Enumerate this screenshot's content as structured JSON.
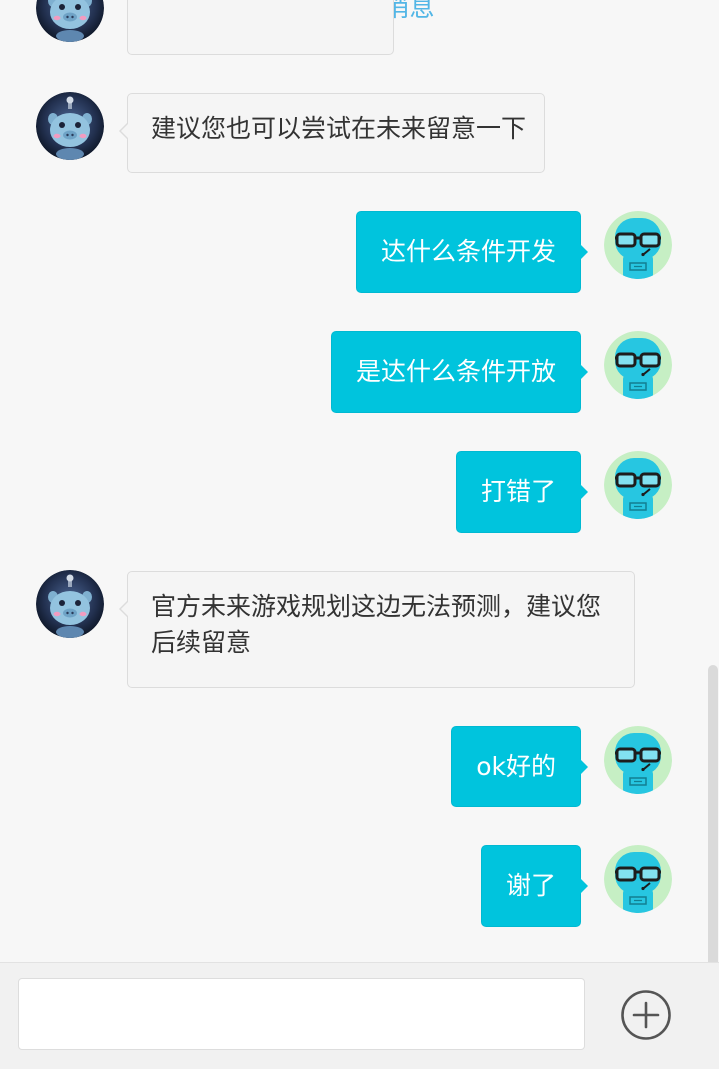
{
  "header": {
    "load_earlier_label": "查看更早消息"
  },
  "participants": {
    "agent": {
      "avatar_icon": "pig-robot-avatar"
    },
    "user": {
      "avatar_icon": "glasses-robot-avatar"
    }
  },
  "messages": [
    {
      "from": "agent",
      "text": "建议您也可以尝试在未来留意一下"
    },
    {
      "from": "user",
      "text": "达什么条件开发"
    },
    {
      "from": "user",
      "text": "是达什么条件开放"
    },
    {
      "from": "user",
      "text": "打错了"
    },
    {
      "from": "agent",
      "text": "官方未来游戏规划这边无法预测，建议您后续留意"
    },
    {
      "from": "user",
      "text": "ok好的"
    },
    {
      "from": "user",
      "text": "谢了"
    }
  ],
  "composer": {
    "input_value": "",
    "input_placeholder": "",
    "add_icon": "plus-circle-icon"
  },
  "colors": {
    "outgoing_bubble": "#00c4dd",
    "outgoing_text": "#ffffff",
    "incoming_bubble": "#f5f5f5",
    "incoming_border": "#dcdcdc",
    "incoming_text": "#333333",
    "link": "#52b6e6",
    "background": "#f7f7f7",
    "composer_background": "#f1f1f1"
  }
}
